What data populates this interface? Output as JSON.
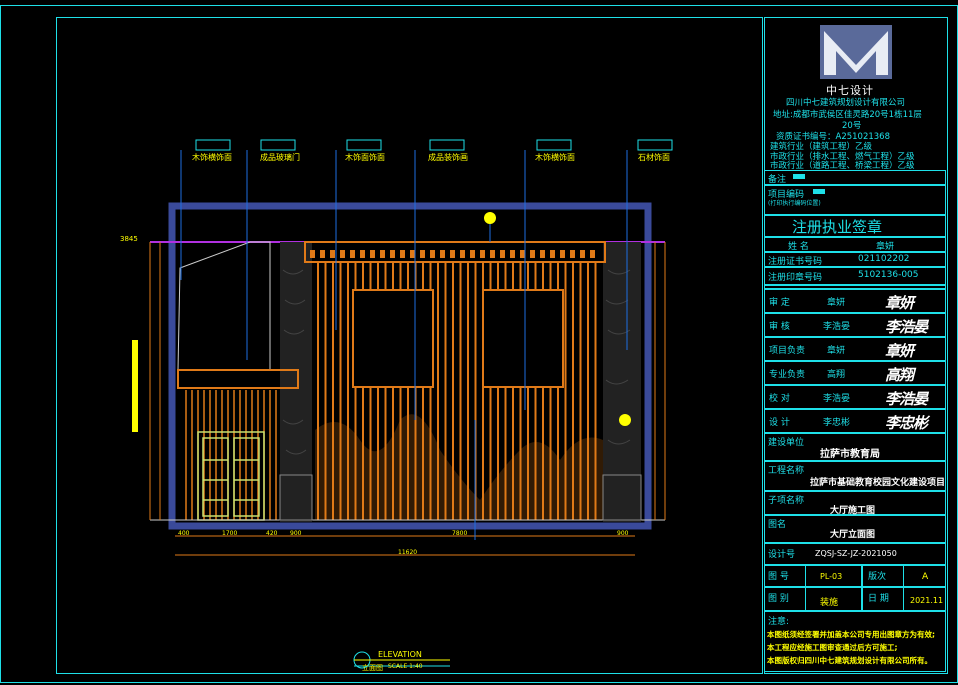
{
  "title_block": {
    "company_logo_text": "中七设计",
    "company_name": "四川中七建筑规划设计有限公司",
    "address": "地址:成都市武侯区佳灵路20号1栋11层",
    "address2": "20号",
    "cert_no": "资质证书编号：A251021368",
    "qual1": "建筑行业（建筑工程）乙级",
    "qual2": "市政行业（排水工程、燃气工程）乙级",
    "qual3": "市政行业（道路工程、桥梁工程）乙级",
    "remark_label": "备注",
    "project_code_label": "项目编码",
    "project_code_note": "(打印执行编码位置)",
    "reg_stamp_title": "注册执业签章",
    "name_label": "姓    名",
    "name_value": "章妍",
    "cert_label": "注册证书号码",
    "cert_value": "021102202",
    "seal_label": "注册印章号码",
    "seal_value": "5102136-005",
    "roles": [
      {
        "label": "审    定",
        "name": "章妍",
        "sig": "章妍"
      },
      {
        "label": "审    核",
        "name": "李浩晏",
        "sig": "李浩晏"
      },
      {
        "label": "项目负责",
        "name": "章妍",
        "sig": "章妍"
      },
      {
        "label": "专业负责",
        "name": "高翔",
        "sig": "高翔"
      },
      {
        "label": "校    对",
        "name": "李浩晏",
        "sig": "李浩晏"
      },
      {
        "label": "设    计",
        "name": "李忠彬",
        "sig": "李忠彬"
      }
    ],
    "client_label": "建设单位",
    "client_value": "拉萨市教育局",
    "project_label": "工程名称",
    "project_value": "拉萨市基础教育校园文化建设项目",
    "subproject_label": "子项名称",
    "subproject_value": "大厅施工图",
    "drawing_name_label": "图名",
    "drawing_name_value": "大厅立面图",
    "design_no_label": "设计号",
    "design_no_value": "ZQSJ-SZ-JZ-2021050",
    "sheet_no_label": "图    号",
    "sheet_no_value": "PL-03",
    "revision_label": "版次",
    "revision_value": "A",
    "category_label": "图    别",
    "category_value": "装施",
    "date_label": "日    期",
    "date_value": "2021.11",
    "notes_label": "注意:",
    "note1": "本图纸须经签署并加盖本公司专用出图章方为有效;",
    "note2": "本工程应经施工图审查通过后方可施工;",
    "note3": "本图版权归四川中七建筑规划设计有限公司所有。"
  },
  "drawing": {
    "callouts": [
      "木饰横饰面",
      "成品玻璃门",
      "木饰面饰面",
      "成品装饰画",
      "木饰横饰面",
      "石材饰面"
    ],
    "dimensions_bottom": [
      "400",
      "1700",
      "420",
      "900",
      "7800",
      "900"
    ],
    "total_dimension": "11620",
    "level_left": "3845",
    "elevation_label": "ELEVATION",
    "scale_label": "立面图",
    "scale_value": "SCALE 1:40"
  },
  "colors": {
    "frame": "#1ee0e8",
    "wood": "#e07a18",
    "wall": "#3a4a9a",
    "purple": "#b030e0",
    "yellow": "#ffff00"
  }
}
